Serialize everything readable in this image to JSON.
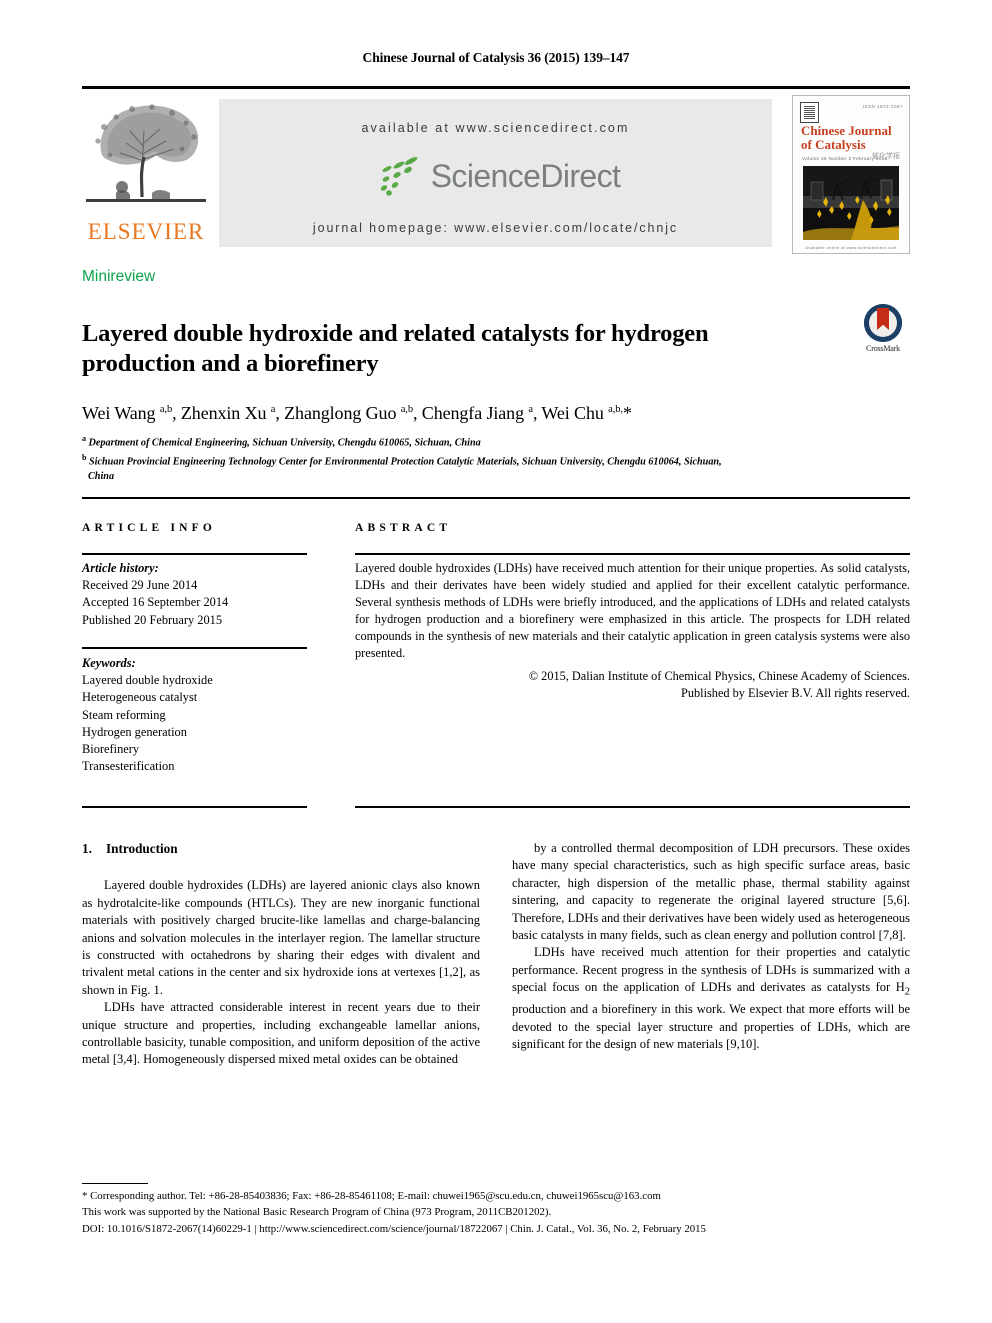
{
  "running_head": "Chinese Journal of Catalysis 36 (2015) 139–147",
  "masthead": {
    "publisher_logo_word": "ELSEVIER",
    "available_at": "available at www.sciencedirect.com",
    "sciencedirect_word": "ScienceDirect",
    "journal_homepage": "journal homepage: www.elsevier.com/locate/chnjc",
    "cover": {
      "title": "Chinese Journal of Catalysis",
      "subtitle": "Volume 36  Number 2  February 2015",
      "chinese_name": "催化学报",
      "top_right": "ISSN 1872-2067",
      "bottom_note": "Available online at www.sciencedirect.com"
    }
  },
  "article": {
    "type_label": "Minireview",
    "title": "Layered double hydroxide and related catalysts for hydrogen production and a biorefinery",
    "crossmark_label": "CrossMark",
    "authors_html": "Wei Wang <sup>a,b</sup>, Zhenxin Xu <sup>a</sup>, Zhanglong Guo <sup>a,b</sup>, Chengfa Jiang <sup>a</sup>, Wei Chu <sup>a,b,</sup>*",
    "affiliations": [
      "Department of Chemical Engineering, Sichuan University, Chengdu 610065, Sichuan, China",
      "Sichuan Provincial Engineering Technology Center for Environmental Protection Catalytic Materials, Sichuan University, Chengdu 610064, Sichuan,",
      "China"
    ],
    "affiliation_marks": [
      "a",
      "b"
    ]
  },
  "info": {
    "heading": "ARTICLE INFO",
    "history_label": "Article history:",
    "history": [
      "Received 29 June 2014",
      "Accepted 16 September 2014",
      "Published 20 February 2015"
    ],
    "keywords_label": "Keywords:",
    "keywords": [
      "Layered double hydroxide",
      "Heterogeneous catalyst",
      "Steam reforming",
      "Hydrogen generation",
      "Biorefinery",
      "Transesterification"
    ]
  },
  "abstract": {
    "heading": "ABSTRACT",
    "text": "Layered double hydroxides (LDHs) have received much attention for their unique properties. As solid catalysts, LDHs and their derivates have been widely studied and applied for their excellent catalytic performance. Several synthesis methods of LDHs were briefly introduced, and the applications of LDHs and related catalysts for hydrogen production and a biorefinery were emphasized in this article. The prospects for LDH related compounds in the synthesis of new materials and their catalytic application in green catalysis systems were also presented.",
    "copyright_line1": "© 2015, Dalian Institute of Chemical Physics, Chinese Academy of Sciences.",
    "copyright_line2": "Published by Elsevier B.V. All rights reserved."
  },
  "body": {
    "section_number": "1.",
    "section_title": "Introduction",
    "left_paragraphs": [
      "Layered double hydroxides (LDHs) are layered anionic clays also known as hydrotalcite-like compounds (HTLCs). They are new inorganic functional materials with positively charged brucite-like lamellas and charge-balancing anions and solvation molecules in the interlayer region. The lamellar structure is constructed with octahedrons by sharing their edges with divalent and trivalent metal cations in the center and six hydroxide ions at vertexes [1,2], as shown in Fig. 1.",
      "LDHs have attracted considerable interest in recent years due to their unique structure and properties, including exchangeable lamellar anions, controllable basicity, tunable composition, and uniform deposition of the active metal [3,4]. Homogeneously dispersed mixed metal oxides can be obtained"
    ],
    "right_paragraphs": [
      "by a controlled thermal decomposition of LDH precursors. These oxides have many special characteristics, such as high specific surface areas, basic character, high dispersion of the metallic phase, thermal stability against sintering, and capacity to regenerate the original layered structure [5,6]. Therefore, LDHs and their derivatives have been widely used as heterogeneous basic catalysts in many fields, such as clean energy and pollution control [7,8].",
      "LDHs have received much attention for their properties and catalytic performance. Recent progress in the synthesis of LDHs is summarized with a special focus on the application of LDHs and derivates as catalysts for H2 production and a biorefinery in this work. We expect that more efforts will be devoted to the special layer structure and properties of LDHs, which are significant for the design of new materials [9,10]."
    ],
    "right_paragraph2_html": "LDHs have received much attention for their properties and catalytic performance. Recent progress in the synthesis of LDHs is summarized with a special focus on the application of LDHs and derivates as catalysts for H<sub>2</sub> production and a biorefinery in this work. We expect that more efforts will be devoted to the special layer structure and properties of LDHs, which are significant for the design of new materials [9,10]."
  },
  "footnotes": {
    "corresponding": "* Corresponding author. Tel: +86-28-85403836; Fax: +86-28-85461108; E-mail: chuwei1965@scu.edu.cn, chuwei1965scu@163.com",
    "funding": "This work was supported by the National Basic Research Program of China (973 Program, 2011CB201202).",
    "doi_line": "DOI: 10.1016/S1872-2067(14)60229-1 | http://www.sciencedirect.com/science/journal/18722067 | Chin. J. Catal., Vol. 36, No. 2, February 2015"
  },
  "colors": {
    "minireview_green": "#0CA44A",
    "elsevier_orange": "#E87722",
    "sciencedirect_gray": "#7c7f81",
    "sciencedirect_green": "#5BA946",
    "cover_red": "#C6401E",
    "crossmark_blue": "#1c3f66",
    "crossmark_red": "#c62b18"
  }
}
